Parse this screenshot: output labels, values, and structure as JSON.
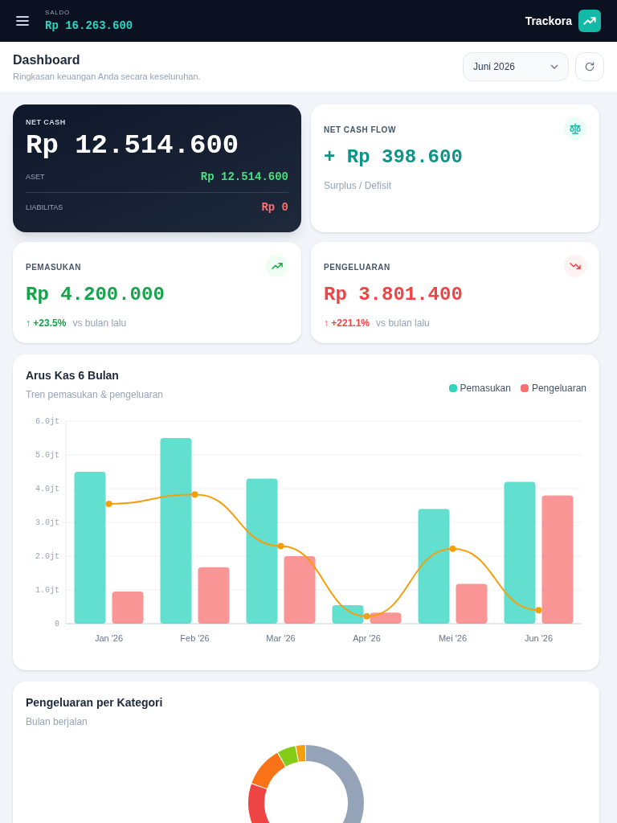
{
  "top_bar": {
    "balance_label": "SALDO",
    "balance": "Rp 16.263.600",
    "brand": "Trackora"
  },
  "header": {
    "title": "Dashboard",
    "subtitle": "Ringkasan keuangan Anda secara keseluruhan.",
    "month_select": "Juni 2026"
  },
  "net_cash": {
    "label": "NET CASH",
    "value": "Rp 12.514.600",
    "rows": [
      {
        "label": "ASET",
        "value": "Rp 12.514.600",
        "kind": "positive"
      },
      {
        "label": "LIABILITAS",
        "value": "Rp 0",
        "kind": "negative"
      }
    ]
  },
  "stats": [
    {
      "label": "NET CASH FLOW",
      "value": "+ Rp 398.600",
      "kind": "flow",
      "note": "Surplus / Defisit"
    },
    {
      "label": "PEMASUKAN",
      "value": "Rp 4.200.000",
      "kind": "income",
      "change": "↑ +23.5%",
      "note": "vs bulan lalu"
    },
    {
      "label": "PENGELUARAN",
      "value": "Rp 3.801.400",
      "kind": "expense",
      "change": "↑ +221.1%",
      "note": "vs bulan lalu"
    }
  ],
  "cashflow_card": {
    "title": "Arus Kas 6 Bulan",
    "subtitle": "Tren pemasukan & pengeluaran",
    "chart_data": {
      "type": "bar",
      "categories": [
        "Jan '26",
        "Feb '26",
        "Mar '26",
        "Apr '26",
        "Mei '26",
        "Jun '26"
      ],
      "series": [
        {
          "name": "Pemasukan",
          "color": "#2dd4bf",
          "values": [
            4.5,
            5.5,
            4.3,
            0.55,
            3.4,
            4.2
          ]
        },
        {
          "name": "Pengeluaran",
          "color": "#f87171",
          "values": [
            0.95,
            1.67,
            2.0,
            0.33,
            1.18,
            3.8
          ]
        },
        {
          "type": "line",
          "color": "#f59e0b",
          "marker": "circle",
          "values": [
            3.55,
            3.83,
            2.3,
            0.22,
            2.22,
            0.4
          ]
        }
      ],
      "grid": true,
      "ylim": [
        0,
        6
      ],
      "yticks": [
        {
          "value": 0,
          "label": "0"
        },
        {
          "value": 1,
          "label": "1.0jt"
        },
        {
          "value": 2,
          "label": "2.0jt"
        },
        {
          "value": 3,
          "label": "3.0jt"
        },
        {
          "value": 4,
          "label": "4.0jt"
        },
        {
          "value": 5,
          "label": "5.0jt"
        },
        {
          "value": 6,
          "label": "6.0jt"
        }
      ]
    }
  },
  "category_card": {
    "title": "Pengeluaran per Kategori",
    "subtitle": "Bulan berjalan"
  }
}
